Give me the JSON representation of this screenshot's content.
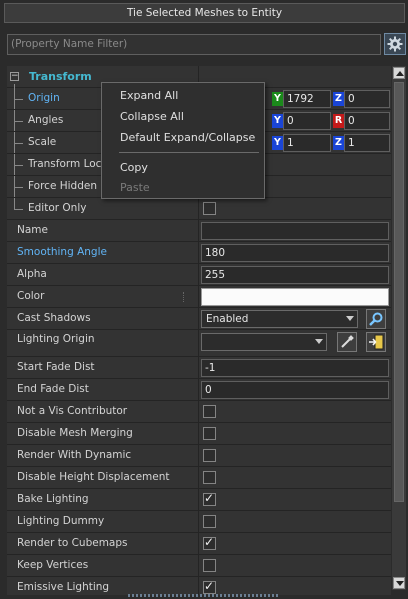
{
  "toolbar": {
    "tie_button": "Tie Selected Meshes to Entity"
  },
  "filter": {
    "placeholder": "(Property Name Filter)"
  },
  "section": {
    "title": "Transform"
  },
  "transform": {
    "origin": {
      "label": "Origin",
      "y_axis": "Y",
      "z_axis": "Z",
      "y": "1792",
      "z": "0"
    },
    "angles": {
      "label": "Angles",
      "y_axis": "Y",
      "r_axis": "R",
      "y": "0",
      "r": "0"
    },
    "scale": {
      "label": "Scale",
      "y_axis": "Y",
      "z_axis": "Z",
      "y": "1",
      "z": "1"
    },
    "transform_lock": {
      "label": "Transform Lock"
    },
    "force_hidden": {
      "label": "Force Hidden"
    },
    "editor_only": {
      "label": "Editor Only",
      "checked": false
    }
  },
  "props": {
    "name": {
      "label": "Name",
      "value": ""
    },
    "smoothing": {
      "label": "Smoothing Angle",
      "value": "180"
    },
    "alpha": {
      "label": "Alpha",
      "value": "255"
    },
    "color": {
      "label": "Color",
      "swatch": "#fbfbfb"
    },
    "cast_shadows": {
      "label": "Cast Shadows",
      "value": "Enabled"
    },
    "lighting_origin": {
      "label": "Lighting Origin",
      "value": ""
    },
    "start_fade": {
      "label": "Start Fade Dist",
      "value": "-1"
    },
    "end_fade": {
      "label": "End Fade Dist",
      "value": "0"
    }
  },
  "checks": [
    {
      "label": "Not a Vis Contributor",
      "checked": false
    },
    {
      "label": "Disable Mesh Merging",
      "checked": false
    },
    {
      "label": "Render With Dynamic",
      "checked": false
    },
    {
      "label": "Disable Height Displacement",
      "checked": false
    },
    {
      "label": "Bake Lighting",
      "checked": true
    },
    {
      "label": "Lighting Dummy",
      "checked": false
    },
    {
      "label": "Render to Cubemaps",
      "checked": true
    },
    {
      "label": "Keep Vertices",
      "checked": false
    },
    {
      "label": "Emissive Lighting",
      "checked": true
    }
  ],
  "context_menu": {
    "expand_all": "Expand All",
    "collapse_all": "Collapse All",
    "default_expand": "Default Expand/Collapse",
    "copy": "Copy",
    "paste": "Paste"
  },
  "colors": {
    "accent": "#61b4f5",
    "section": "#45b9d1"
  }
}
